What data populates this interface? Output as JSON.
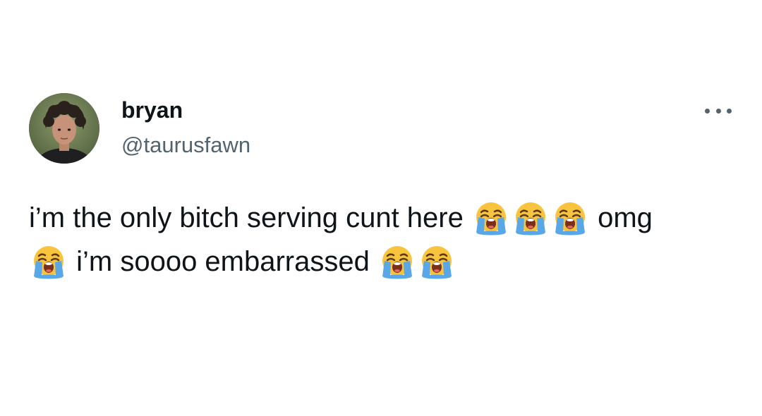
{
  "author": {
    "display_name": "bryan",
    "handle": "@taurusfawn",
    "avatar_icon": "profile-photo"
  },
  "menu": {
    "icon": "more-horizontal-icon"
  },
  "tweet": {
    "line1_text": "i’m the only bitch serving cunt here",
    "line1_emoji_count": 3,
    "line1_tail": "omg",
    "line2_text": "i’m soooo embarrassed",
    "line2_emoji_count": 2
  },
  "emoji": {
    "name": "loudly-crying-face",
    "face_color": "#f8c43d",
    "tear_color": "#5aa7e8"
  },
  "colors": {
    "primary_text": "#0f1419",
    "secondary_text": "#536471",
    "background": "#ffffff"
  }
}
